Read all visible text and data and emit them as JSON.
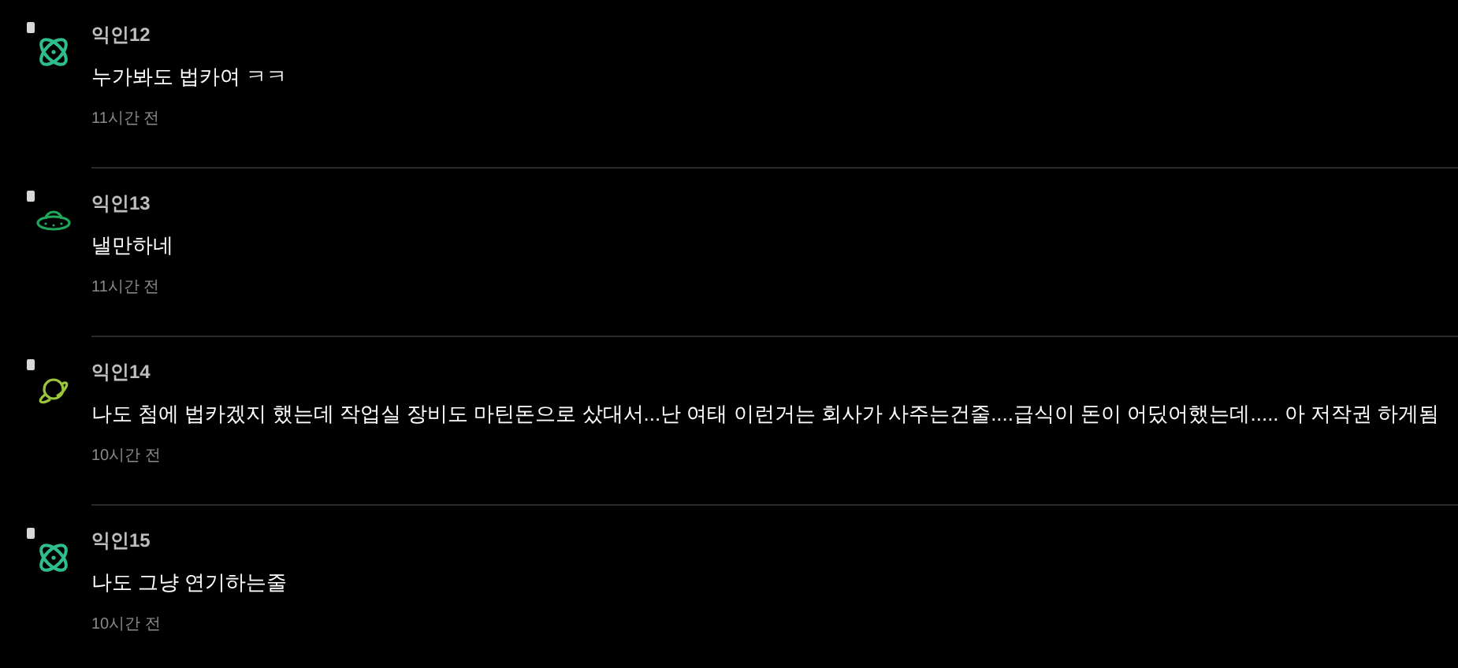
{
  "comments": [
    {
      "avatar": {
        "kind": "atom",
        "color": "#2ebd8c"
      },
      "author": "익인12",
      "text": "누가봐도 법카여 ㅋㅋ",
      "time": "11시간 전"
    },
    {
      "avatar": {
        "kind": "ufo",
        "color": "#1fa85c"
      },
      "author": "익인13",
      "text": "낼만하네",
      "time": "11시간 전"
    },
    {
      "avatar": {
        "kind": "planet",
        "color": "#9bc53d"
      },
      "author": "익인14",
      "text": "나도 첨에 법카겠지 했는데 작업실 장비도 마틴돈으로 샀대서...난 여태 이런거는 회사가 사주는건줄....급식이 돈이 어딨어했는데..... 아 저작권 하게됨",
      "time": "10시간 전"
    },
    {
      "avatar": {
        "kind": "atom",
        "color": "#2ebd8c"
      },
      "author": "익인15",
      "text": "나도 그냥 연기하는줄",
      "time": "10시간 전"
    }
  ]
}
